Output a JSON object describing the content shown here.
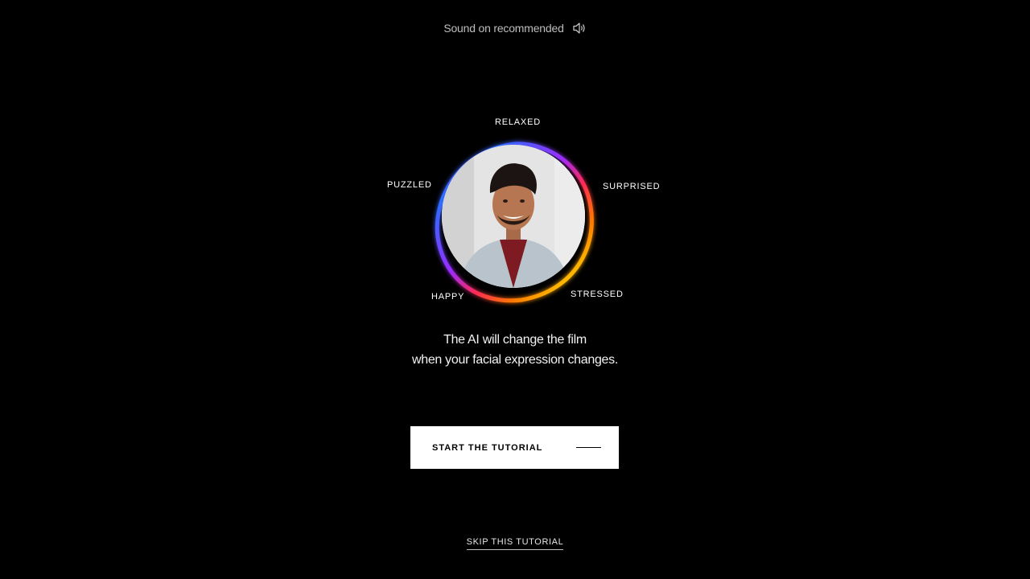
{
  "header": {
    "sound_hint": "Sound on recommended",
    "sound_icon": "speaker-icon"
  },
  "mood_wheel": {
    "labels": {
      "top": "RELAXED",
      "top_left": "PUZZLED",
      "top_right": "SURPRISED",
      "bottom_left": "HAPPY",
      "bottom_right": "STRESSED"
    },
    "ring_colors": [
      "#2f6bff",
      "#7a3cff",
      "#d62cff",
      "#ff2a2a",
      "#ff7a00",
      "#ffd400",
      "#a8ff3e",
      "#2fe0ff"
    ],
    "portrait_alt": "smiling man"
  },
  "caption": {
    "line1": "The AI will change the film",
    "line2": "when your facial expression changes."
  },
  "actions": {
    "start_label": "START THE TUTORIAL",
    "skip_label": "SKIP THIS TUTORIAL"
  }
}
